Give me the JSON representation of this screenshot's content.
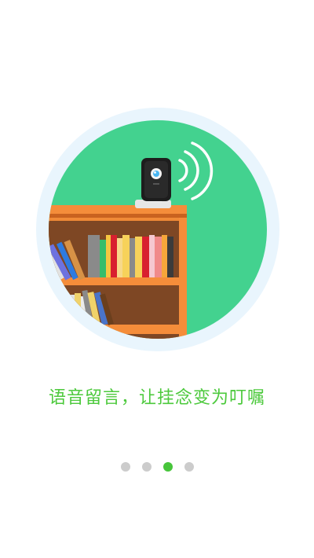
{
  "onboarding": {
    "caption": "语音留言，让挂念变为叮嘱",
    "illustration": {
      "subject": "camera-on-bookshelf",
      "colors": {
        "ring": "#e9f5fd",
        "background": "#43d28f",
        "shelf_wood": "#f0822e",
        "shelf_dark": "#7e4724",
        "camera_body": "#1d1d1d",
        "camera_base": "#f2f2f2"
      }
    },
    "pager": {
      "total": 4,
      "active_index": 2,
      "colors": {
        "active": "#47c53b",
        "inactive": "#cccccc"
      }
    }
  }
}
